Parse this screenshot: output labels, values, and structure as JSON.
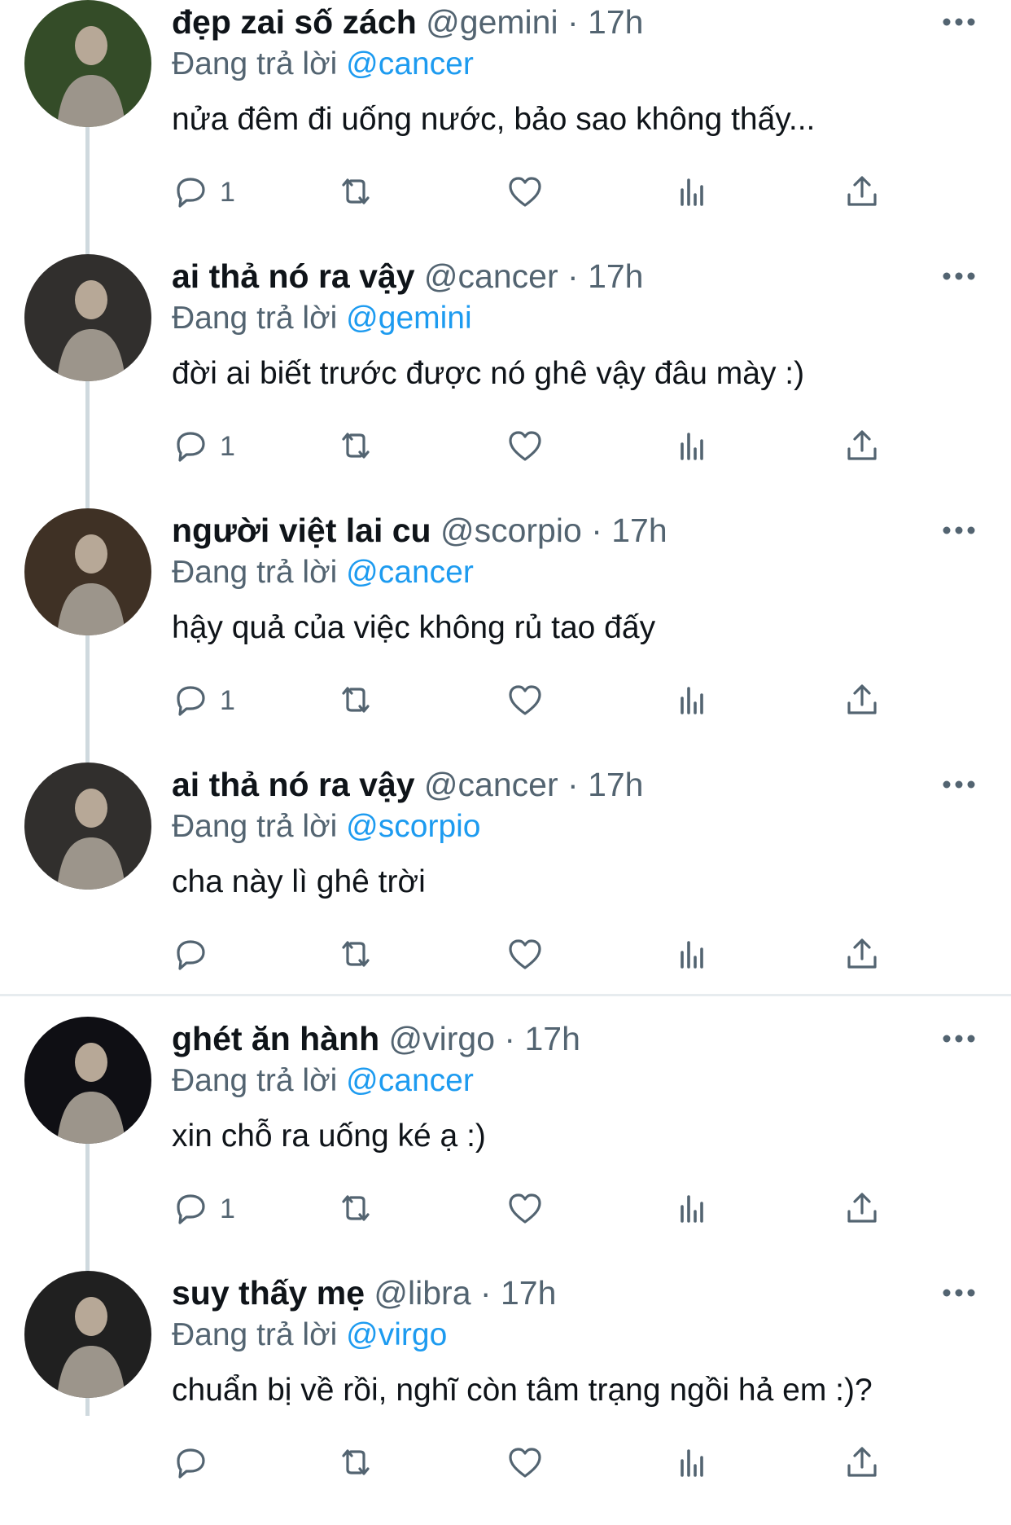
{
  "reply_prefix": "Đang trả lời",
  "separator": "·",
  "colors": {
    "accent": "#1d9bf0",
    "muted": "#536471",
    "text": "#0f1419",
    "thread_line": "#cfd9de"
  },
  "action_icons": [
    "reply-icon",
    "retweet-icon",
    "like-icon",
    "views-icon",
    "share-icon"
  ],
  "tweets": [
    {
      "name": "đẹp zai số zách",
      "handle": "@gemini",
      "time": "17h",
      "replying_to": "@cancer",
      "text": "nửa đêm đi uống nước, bảo sao không thấy...",
      "reply_count": "1"
    },
    {
      "name": "ai thả nó ra vậy",
      "handle": "@cancer",
      "time": "17h",
      "replying_to": "@gemini",
      "text": "đời ai biết trước được nó ghê vậy đâu mày :)",
      "reply_count": "1"
    },
    {
      "name": "người việt lai cu",
      "handle": "@scorpio",
      "time": "17h",
      "replying_to": "@cancer",
      "text": "hậy quả của việc không rủ tao đấy",
      "reply_count": "1"
    },
    {
      "name": "ai thả nó ra vậy",
      "handle": "@cancer",
      "time": "17h",
      "replying_to": "@scorpio",
      "text": "cha này lì ghê trời",
      "reply_count": ""
    },
    {
      "name": "ghét ăn hành",
      "handle": "@virgo",
      "time": "17h",
      "replying_to": "@cancer",
      "text": "xin chỗ ra uống ké ạ :)",
      "reply_count": "1"
    },
    {
      "name": "suy thấy mẹ",
      "handle": "@libra",
      "time": "17h",
      "replying_to": "@virgo",
      "text": "chuẩn bị về rồi, nghĩ còn tâm trạng ngồi hả em :)?",
      "reply_count": ""
    }
  ]
}
